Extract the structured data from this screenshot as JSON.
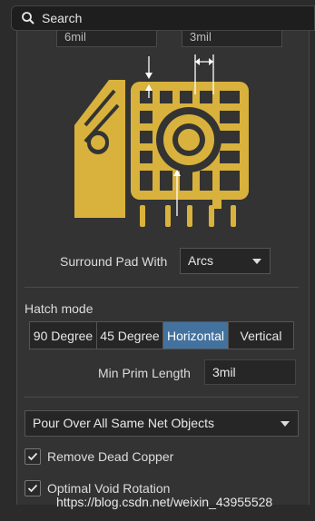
{
  "search": {
    "label": "Search",
    "icon": "search-icon"
  },
  "clearance": {
    "left_value": "6mil",
    "right_value": "3mil"
  },
  "diagram": {
    "description_icon": "thermal-relief-pad-diagram",
    "color": "#d8b23c"
  },
  "surround": {
    "label": "Surround Pad With",
    "value": "Arcs"
  },
  "hatch": {
    "label": "Hatch mode",
    "options": [
      "90 Degree",
      "45 Degree",
      "Horizontal",
      "Vertical"
    ],
    "selected": "Horizontal"
  },
  "min_prim": {
    "label": "Min Prim Length",
    "value": "3mil"
  },
  "pour": {
    "value": "Pour Over All Same Net Objects"
  },
  "checks": {
    "remove_dead_copper": {
      "label": "Remove Dead Copper",
      "checked": true
    },
    "optimal_void_rotation": {
      "label": "Optimal Void Rotation",
      "checked": true
    }
  },
  "watermark": "https://blog.csdn.net/weixin_43955528",
  "colors": {
    "accent": "#44729e",
    "copper": "#d8b23c"
  }
}
